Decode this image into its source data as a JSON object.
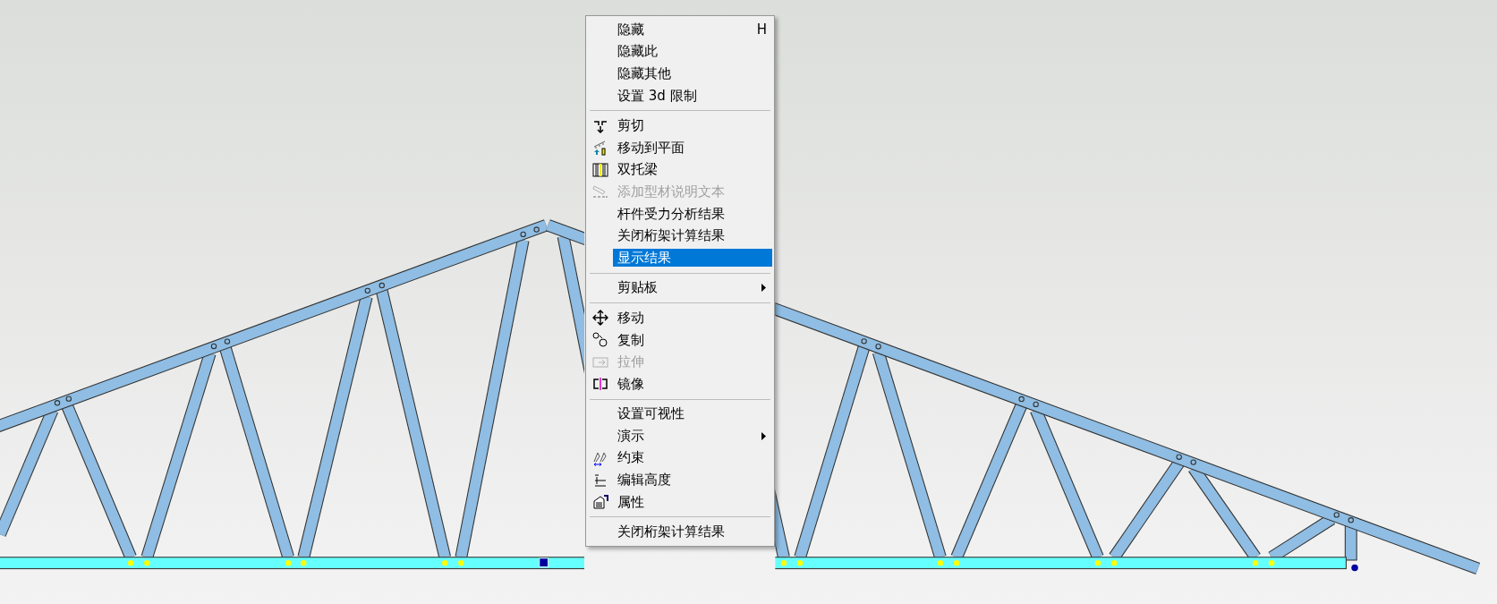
{
  "context_menu": {
    "items": [
      {
        "kind": "item",
        "label": "隐藏",
        "shortcut": "H",
        "disabled": false,
        "selected": false
      },
      {
        "kind": "item",
        "label": "隐藏此",
        "disabled": false,
        "selected": false
      },
      {
        "kind": "item",
        "label": "隐藏其他",
        "disabled": false,
        "selected": false
      },
      {
        "kind": "item",
        "label": "设置 3d 限制",
        "disabled": false,
        "selected": false
      },
      {
        "kind": "separator"
      },
      {
        "kind": "item",
        "label": "剪切",
        "disabled": false,
        "selected": false
      },
      {
        "kind": "item",
        "label": "移动到平面",
        "disabled": false,
        "selected": false
      },
      {
        "kind": "item",
        "label": "双托梁",
        "disabled": false,
        "selected": false
      },
      {
        "kind": "item",
        "label": "添加型材说明文本",
        "disabled": true,
        "selected": false
      },
      {
        "kind": "item",
        "label": "杆件受力分析结果",
        "disabled": false,
        "selected": false
      },
      {
        "kind": "item",
        "label": "关闭桁架计算结果",
        "disabled": false,
        "selected": false
      },
      {
        "kind": "item",
        "label": "显示结果",
        "disabled": false,
        "selected": true
      },
      {
        "kind": "separator"
      },
      {
        "kind": "item",
        "label": "剪贴板",
        "submenu": true,
        "disabled": false,
        "selected": false
      },
      {
        "kind": "separator"
      },
      {
        "kind": "item",
        "label": "移动",
        "disabled": false,
        "selected": false
      },
      {
        "kind": "item",
        "label": "复制",
        "disabled": false,
        "selected": false
      },
      {
        "kind": "item",
        "label": "拉伸",
        "disabled": true,
        "selected": false
      },
      {
        "kind": "item",
        "label": "镜像",
        "disabled": false,
        "selected": false
      },
      {
        "kind": "separator"
      },
      {
        "kind": "item",
        "label": "设置可视性",
        "disabled": false,
        "selected": false
      },
      {
        "kind": "item",
        "label": "演示",
        "submenu": true,
        "disabled": false,
        "selected": false
      },
      {
        "kind": "item",
        "label": "约束",
        "disabled": false,
        "selected": false
      },
      {
        "kind": "item",
        "label": "编辑高度",
        "disabled": false,
        "selected": false
      },
      {
        "kind": "item",
        "label": "属性",
        "disabled": false,
        "selected": false
      },
      {
        "kind": "separator"
      },
      {
        "kind": "item",
        "label": "关闭桁架计算结果",
        "disabled": false,
        "selected": false
      }
    ]
  }
}
